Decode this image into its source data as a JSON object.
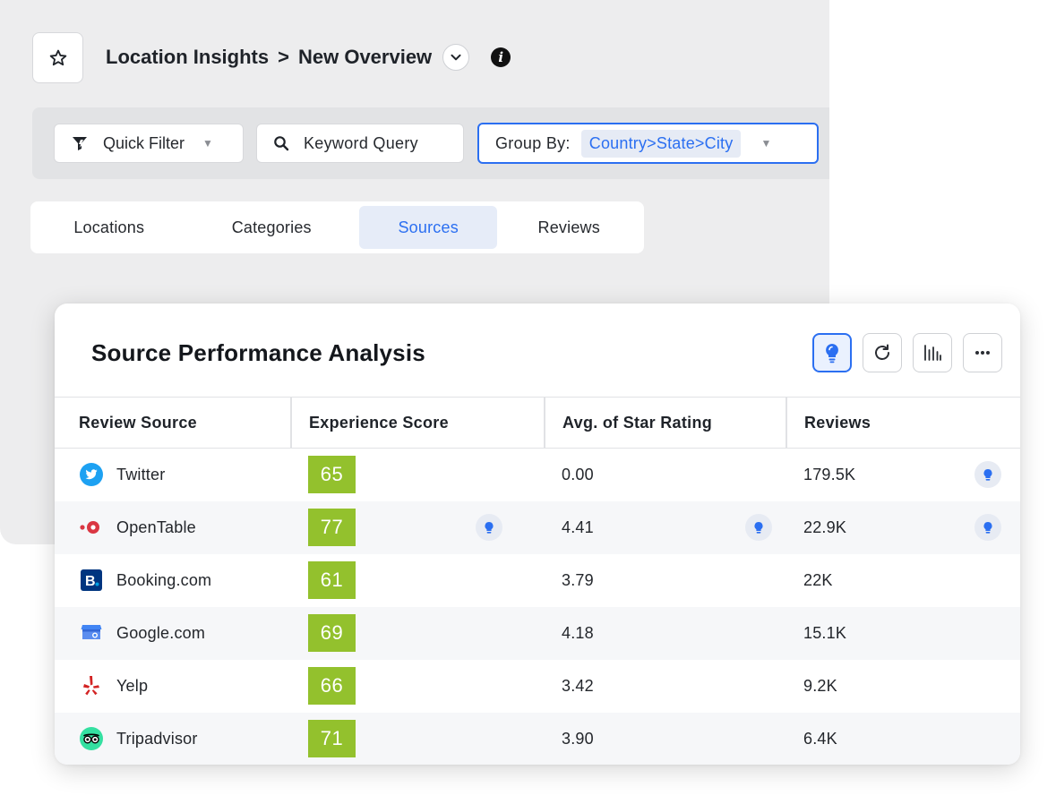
{
  "header": {
    "breadcrumb_root": "Location Insights",
    "breadcrumb_sep": ">",
    "breadcrumb_current": "New Overview"
  },
  "filters": {
    "quick_filter_label": "Quick Filter",
    "keyword_label": "Keyword Query",
    "group_by_label": "Group By:",
    "group_by_value": "Country>State>City"
  },
  "tabs": [
    {
      "label": "Locations",
      "active": false
    },
    {
      "label": "Categories",
      "active": false
    },
    {
      "label": "Sources",
      "active": true
    },
    {
      "label": "Reviews",
      "active": false
    }
  ],
  "card": {
    "title": "Source Performance Analysis",
    "actions": [
      "lightbulb-icon",
      "refresh-icon",
      "chart-icon",
      "more-icon"
    ]
  },
  "table": {
    "columns": [
      "Review Source",
      "Experience Score",
      "Avg. of Star Rating",
      "Reviews"
    ],
    "rows": [
      {
        "source": "Twitter",
        "icon": "twitter-icon",
        "score": "65",
        "rating": "0.00",
        "reviews": "179.5K"
      },
      {
        "source": "OpenTable",
        "icon": "opentable-icon",
        "score": "77",
        "rating": "4.41",
        "reviews": "22.9K"
      },
      {
        "source": "Booking.com",
        "icon": "booking-icon",
        "score": "61",
        "rating": "3.79",
        "reviews": "22K"
      },
      {
        "source": "Google.com",
        "icon": "google-business-icon",
        "score": "69",
        "rating": "4.18",
        "reviews": "15.1K"
      },
      {
        "source": "Yelp",
        "icon": "yelp-icon",
        "score": "66",
        "rating": "3.42",
        "reviews": "9.2K"
      },
      {
        "source": "Tripadvisor",
        "icon": "tripadvisor-icon",
        "score": "71",
        "rating": "3.90",
        "reviews": "6.4K"
      }
    ]
  },
  "colors": {
    "accent": "#2b6ff1",
    "score_green": "#93c12d",
    "twitter": "#1da1f2",
    "opentable": "#da3743",
    "booking": "#003580",
    "google": "#4285f4",
    "yelp": "#d32323",
    "tripadvisor": "#34e0a1"
  }
}
